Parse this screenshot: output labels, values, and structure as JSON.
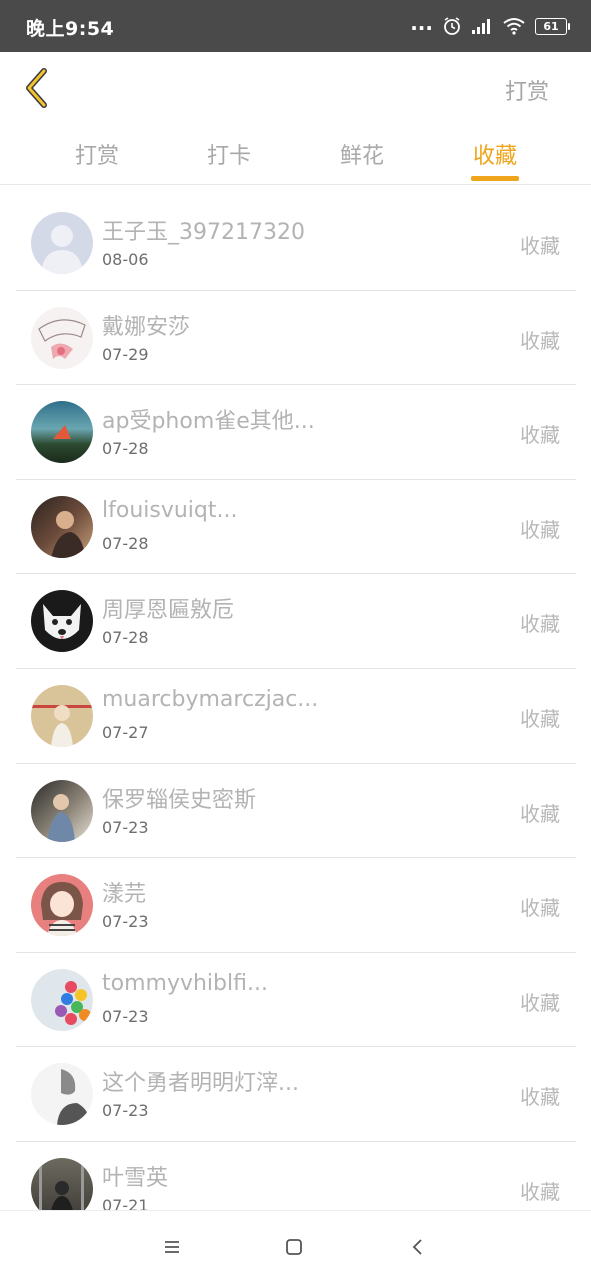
{
  "status_bar": {
    "time": "晚上9:54",
    "dots": "...",
    "battery": "61",
    "icons": [
      "alarm-icon",
      "signal-icon",
      "wifi-icon",
      "battery-icon"
    ]
  },
  "header": {
    "back_icon": "chevron-left-icon",
    "action_label": "打赏"
  },
  "tabs": [
    {
      "label": "打赏",
      "active": false
    },
    {
      "label": "打卡",
      "active": false
    },
    {
      "label": "鲜花",
      "active": false
    },
    {
      "label": "收藏",
      "active": true
    }
  ],
  "colors": {
    "accent": "#efa51b",
    "status_bar": "#4a4a4a",
    "muted_text": "#b3b3b3"
  },
  "list": [
    {
      "name": "王子玉_397217320",
      "date": "08-06",
      "action": "收藏"
    },
    {
      "name": "戴娜安莎",
      "date": "07-29",
      "action": "收藏"
    },
    {
      "name": "ap受phom雀e其他...",
      "date": "07-28",
      "action": "收藏"
    },
    {
      "name": "lfouisvuiqt...",
      "date": "07-28",
      "action": "收藏"
    },
    {
      "name": "周厚恩匾敫卮",
      "date": "07-28",
      "action": "收藏"
    },
    {
      "name": "muarcbymarczjac...",
      "date": "07-27",
      "action": "收藏"
    },
    {
      "name": "保罗辎侯史密斯",
      "date": "07-23",
      "action": "收藏"
    },
    {
      "name": "漾芫",
      "date": "07-23",
      "action": "收藏"
    },
    {
      "name": "tommyvhiblfi...",
      "date": "07-23",
      "action": "收藏"
    },
    {
      "name": "这个勇者明明灯滓...",
      "date": "07-23",
      "action": "收藏"
    },
    {
      "name": "叶雪英",
      "date": "07-21",
      "action": "收藏"
    }
  ],
  "nav_bar": {
    "icons": [
      "menu-icon",
      "home-icon",
      "back-icon"
    ]
  }
}
